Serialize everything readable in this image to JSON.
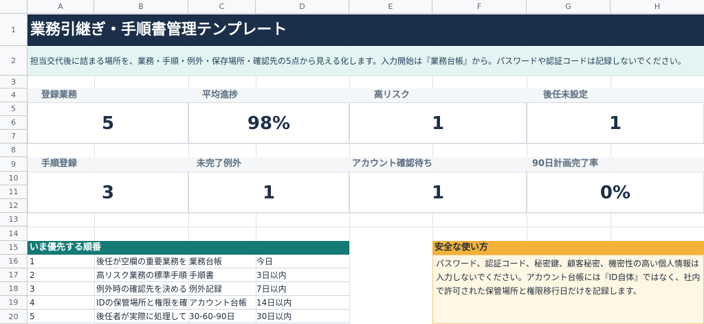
{
  "columns": [
    "A",
    "B",
    "C",
    "D",
    "E",
    "F",
    "G",
    "H"
  ],
  "rows": [
    "1",
    "2",
    "3",
    "4",
    "5",
    "6",
    "7",
    "8",
    "9",
    "10",
    "11",
    "12",
    "13",
    "14",
    "15",
    "16",
    "17",
    "18",
    "19",
    "20"
  ],
  "title": "業務引継ぎ・手順書管理テンプレート",
  "intro": "担当交代後に詰まる場所を、業務・手順・例外・保存場所・確認先の5点から見える化します。入力開始は『業務台帳』から。パスワードや認証コードは記録しないでください。",
  "kpis_row1": [
    {
      "label": "登録業務",
      "value": "5"
    },
    {
      "label": "平均進捗",
      "value": "98%"
    },
    {
      "label": "高リスク",
      "value": "1"
    },
    {
      "label": "後任未設定",
      "value": "1"
    }
  ],
  "kpis_row2": [
    {
      "label": "手順登録",
      "value": "3"
    },
    {
      "label": "未完了例外",
      "value": "1"
    },
    {
      "label": "アカウント確認待ち",
      "value": "1"
    },
    {
      "label": "90日計画完了率",
      "value": "0%"
    }
  ],
  "priority": {
    "header": "いま優先する順番",
    "rows": [
      {
        "num": "1",
        "task": "後任が空欄の重要業務を",
        "sheet": "業務台帳",
        "due": "今日"
      },
      {
        "num": "2",
        "task": "高リスク業務の標準手順",
        "sheet": "手順書",
        "due": "3日以内"
      },
      {
        "num": "3",
        "task": "例外時の確認先を決める",
        "sheet": "例外記録",
        "due": "7日以内"
      },
      {
        "num": "4",
        "task": "IDの保管場所と権限を確",
        "sheet": "アカウント台帳",
        "due": "14日以内"
      },
      {
        "num": "5",
        "task": "後任者が実際に処理して",
        "sheet": "30-60-90日",
        "due": "30日以内"
      }
    ]
  },
  "safety": {
    "header": "安全な使い方",
    "body": "パスワード、認証コード、秘密鍵、顧客秘密、機密性の高い個人情報は入力しないでください。アカウント台帳には『ID自体』ではなく、社内で許可された保管場所と権限移行日だけを記録します。"
  }
}
